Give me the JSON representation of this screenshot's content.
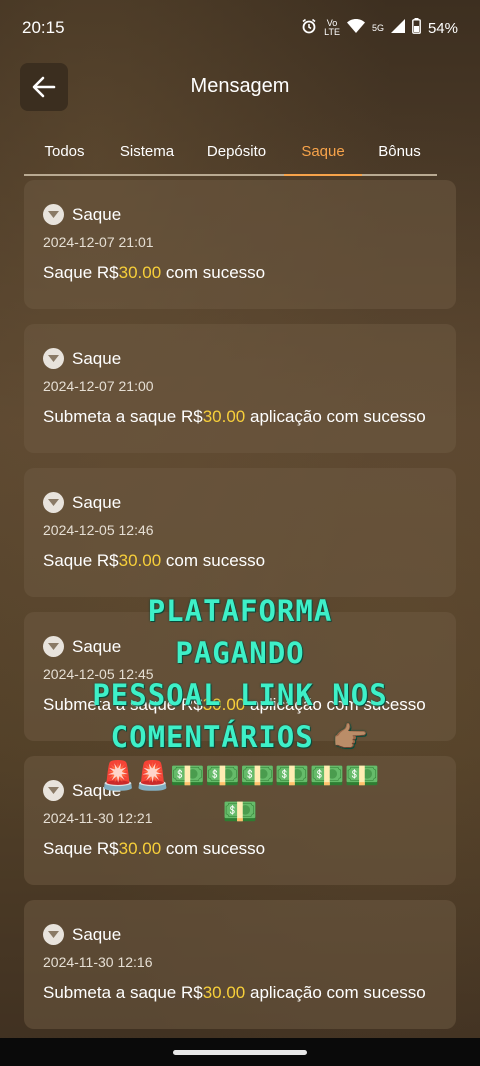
{
  "status": {
    "time": "20:15",
    "network_label": "5G",
    "battery": "54%"
  },
  "header": {
    "title": "Mensagem"
  },
  "tabs": [
    {
      "label": "Todos",
      "active": false
    },
    {
      "label": "Sistema",
      "active": false
    },
    {
      "label": "Depósito",
      "active": false
    },
    {
      "label": "Saque",
      "active": true
    },
    {
      "label": "Bônus",
      "active": false
    }
  ],
  "messages": [
    {
      "type": "Saque",
      "date": "2024-12-07 21:01",
      "prefix": "Saque R$",
      "amount": "30.00",
      "suffix": " com sucesso"
    },
    {
      "type": "Saque",
      "date": "2024-12-07 21:00",
      "prefix": "Submeta a saque R$",
      "amount": "30.00",
      "suffix": " aplicação com sucesso"
    },
    {
      "type": "Saque",
      "date": "2024-12-05 12:46",
      "prefix": "Saque R$",
      "amount": "30.00",
      "suffix": " com sucesso"
    },
    {
      "type": "Saque",
      "date": "2024-12-05 12:45",
      "prefix": "Submeta a saque R$",
      "amount": "30.00",
      "suffix": " aplicação com sucesso"
    },
    {
      "type": "Saque",
      "date": "2024-11-30 12:21",
      "prefix": "Saque R$",
      "amount": "30.00",
      "suffix": " com sucesso"
    },
    {
      "type": "Saque",
      "date": "2024-11-30 12:16",
      "prefix": "Submeta a saque R$",
      "amount": "30.00",
      "suffix": " aplicação com sucesso"
    }
  ],
  "overlay": {
    "line1": "PLATAFORMA",
    "line2": "PAGANDO",
    "line3": "PESSOAL LINK NOS",
    "line4": "COMENTÁRIOS",
    "pointing_emoji": "👉🏽",
    "emoji_row1": "🚨🚨💵💵💵💵💵💵",
    "emoji_row2": "💵"
  },
  "colors": {
    "accent_tab": "#f7a34a",
    "amount": "#f7cf3a",
    "overlay_text": "#3ef0c8"
  }
}
